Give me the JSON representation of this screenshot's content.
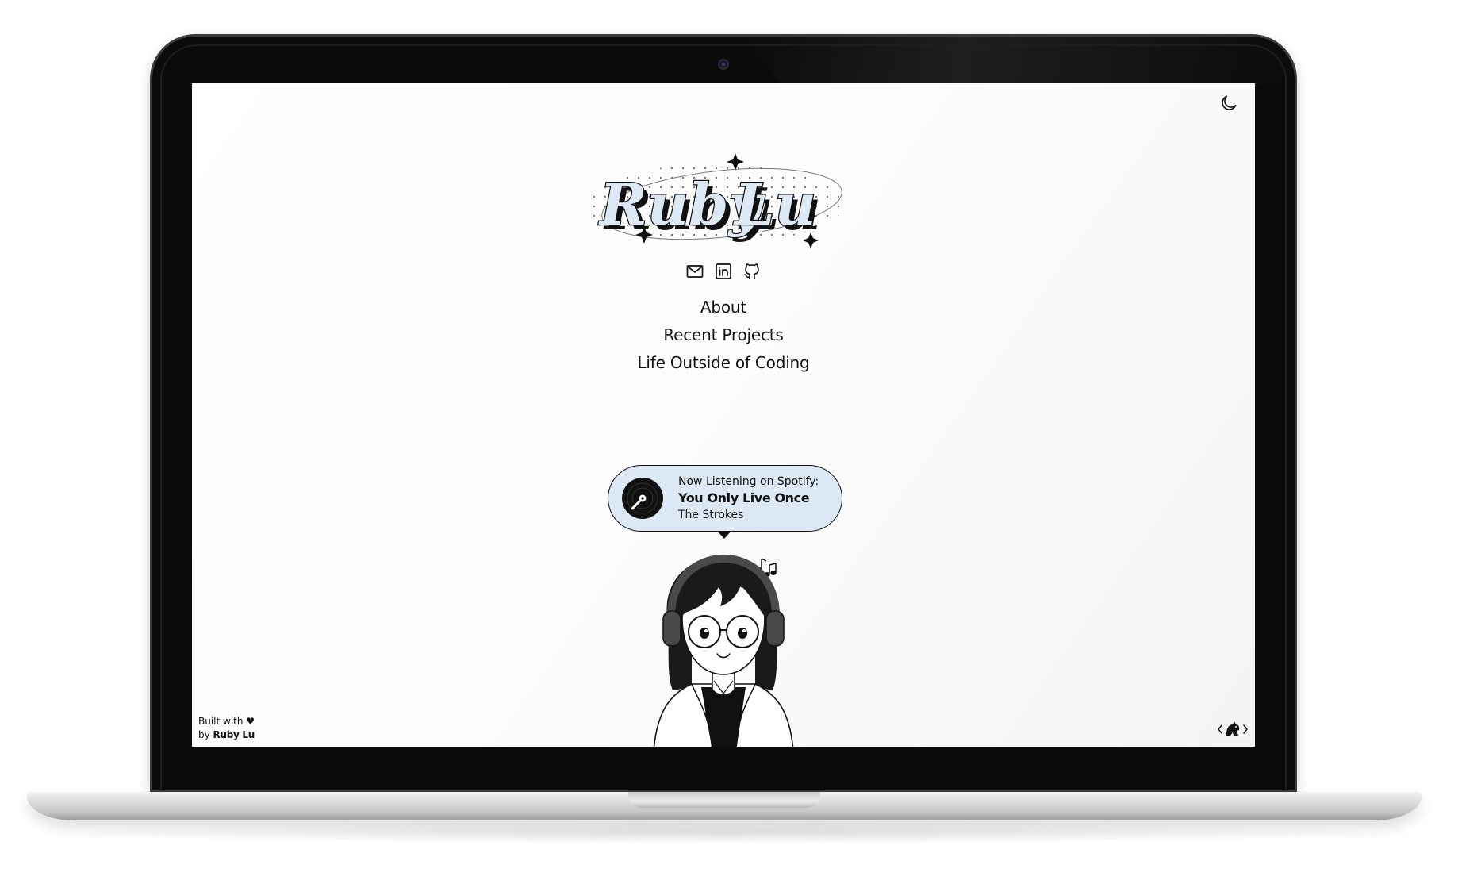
{
  "nav": {
    "about": "About",
    "projects": "Recent Projects",
    "life": "Life Outside of Coding"
  },
  "social": [
    "email-icon",
    "linkedin-icon",
    "github-icon"
  ],
  "theme_toggle_icon": "moon-icon",
  "spotify": {
    "label": "Now Listening on Spotify:",
    "song": "You Only Live Once",
    "artist": "The Strokes",
    "bubble_color": "#dce8f4"
  },
  "footer": {
    "built_with": "Built with",
    "heart": "♥",
    "by": "by",
    "author": "Ruby Lu"
  },
  "colors": {
    "ink": "#111111",
    "accent_blue": "#dce8f4"
  }
}
